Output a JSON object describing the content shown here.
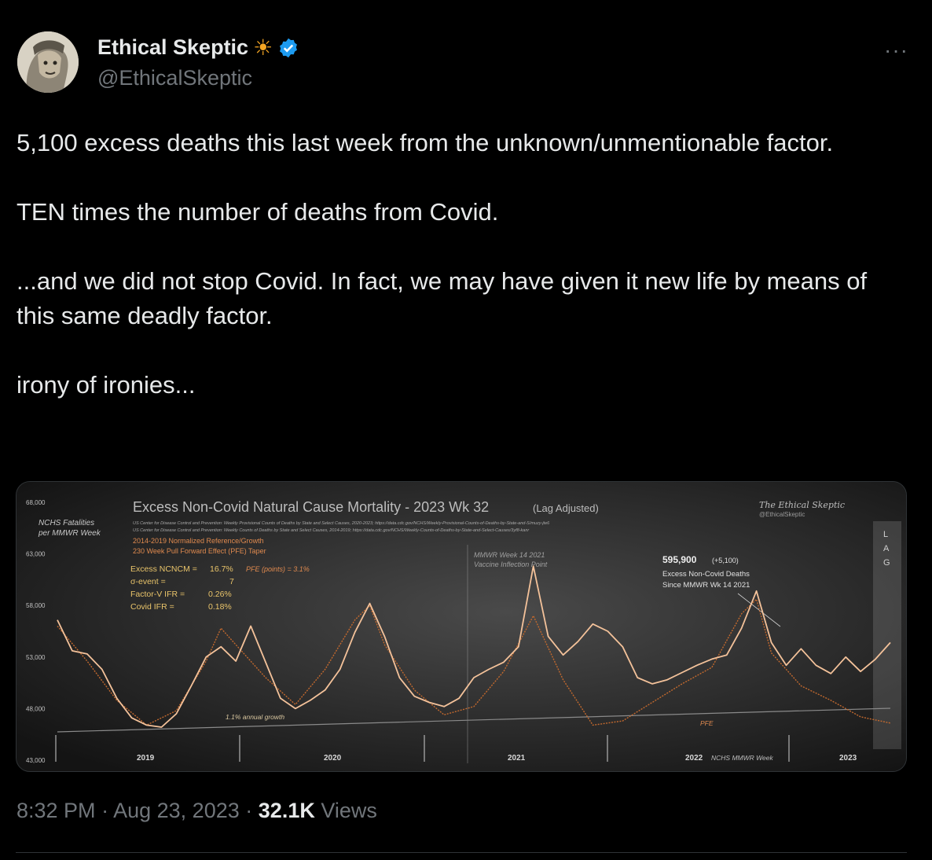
{
  "user": {
    "name": "Ethical Skeptic",
    "handle": "@EthicalSkeptic",
    "sun_emoji": "☀",
    "verified_icon": "verified-badge-icon"
  },
  "menu": {
    "more_label": "···"
  },
  "tweet": {
    "paragraphs": [
      "5,100 excess deaths this last week from the unknown/unmentionable factor.",
      "TEN times the number of deaths from Covid.",
      "...and we did not stop Covid. In fact, we may have given it new life by means of this same deadly factor.",
      "irony of ironies..."
    ]
  },
  "meta": {
    "time": "8:32 PM",
    "date": "Aug 23, 2023",
    "views_count": "32.1K",
    "views_label": "Views",
    "sep": "·"
  },
  "image": {
    "title": "Excess Non-Covid Natural Cause Mortality - 2023 Wk 32",
    "title_suffix": "(Lag Adjusted)",
    "source_line1": "US Center for Disease Control and Prevention: Weekly Provisional Counts of Deaths by State and Select Causes, 2020-2023; https://data.cdc.gov/NCHS/Weekly-Provisional-Counts-of-Deaths-by-State-and-S/muzy-jte6",
    "source_line2": "US Center for Disease Control and Prevention: Weekly Counts of Deaths by State and Select Causes, 2014-2019; https://data.cdc.gov/NCHS/Weekly-Counts-of-Deaths-by-State-and-Select-Causes/3yf8-kanr",
    "ref_line1": "2014-2019 Normalized Reference/Growth",
    "ref_line2": "230 Week Pull Forward Effect (PFE) Taper",
    "ylabel_line1": "NCHS Fatalities",
    "ylabel_line2": "per MMWR Week",
    "brand": "The Ethical Skeptic",
    "brand_handle": "@EthicalSkeptic",
    "stats": [
      {
        "label": "Excess NCNCM =",
        "value": "16.7%"
      },
      {
        "label": "σ-event =",
        "value": "7"
      },
      {
        "label": "Factor-V IFR =",
        "value": "0.26%"
      },
      {
        "label": "Covid IFR =",
        "value": "0.18%"
      }
    ],
    "pfe_points": "PFE (points) = 3.1%",
    "mmwr_note_line1": "MMWR Week 14 2021",
    "mmwr_note_line2": "Vaccine Inflection Point",
    "total": "595,900",
    "total_delta": "(+5,100)",
    "total_line1": "Excess Non-Covid Deaths",
    "total_line2": "Since MMWR Wk 14 2021",
    "growth_label": "1.1% annual growth",
    "pfe_label": "PFE",
    "lag_letters": [
      "L",
      "A",
      "G"
    ],
    "nchs_week_label": "NCHS MMWR Week"
  },
  "chart_data": {
    "type": "line",
    "title": "Excess Non-Covid Natural Cause Mortality - 2023 Wk 32 (Lag Adjusted)",
    "ylabel": "NCHS Fatalities per MMWR Week",
    "xlabel": "NCHS MMWR Week",
    "ylim": [
      43000,
      68000
    ],
    "yticks": [
      "68,000",
      "63,000",
      "58,000",
      "53,000",
      "48,000",
      "43,000"
    ],
    "year_labels": [
      "2019",
      "2020",
      "2021",
      "2022",
      "2023"
    ],
    "grid": false,
    "series": [
      {
        "name": "",
        "color": "#f4c29a",
        "x": [
          0,
          4,
          8,
          12,
          16,
          20,
          24,
          28,
          32,
          36,
          40,
          44,
          48,
          52,
          56,
          60,
          64,
          68,
          72,
          76,
          80,
          84,
          88,
          92,
          96,
          100,
          104,
          108,
          112,
          116,
          120,
          124,
          128,
          132,
          136,
          140,
          144,
          148,
          152,
          156,
          160,
          164,
          168,
          172,
          176,
          180,
          184,
          188,
          192,
          196,
          200,
          204,
          208,
          212,
          216,
          220,
          224
        ],
        "values": [
          56600,
          53600,
          53300,
          51800,
          49000,
          47100,
          46400,
          46200,
          47500,
          50200,
          53000,
          54000,
          52600,
          56000,
          52500,
          49000,
          48000,
          48800,
          49800,
          51800,
          55400,
          58200,
          55000,
          51000,
          49200,
          48600,
          48200,
          49000,
          51000,
          51800,
          52500,
          54000,
          61800,
          55000,
          53200,
          54500,
          56200,
          55500,
          54000,
          51000,
          50400,
          50800,
          51500,
          52200,
          52800,
          53200,
          55800,
          59400,
          54400,
          52200,
          53800,
          52200,
          51400,
          53000,
          51600,
          52800,
          54400
        ]
      },
      {
        "name": "PFE",
        "color": "#c2692e",
        "x": [
          0,
          8,
          16,
          24,
          32,
          40,
          44,
          48,
          56,
          64,
          72,
          80,
          84,
          88,
          96,
          104,
          112,
          120,
          128,
          136,
          144,
          152,
          160,
          168,
          176,
          184,
          188,
          192,
          200,
          208,
          216,
          224
        ],
        "values": [
          56000,
          52600,
          48800,
          46400,
          47800,
          52600,
          55800,
          54200,
          51000,
          48400,
          51800,
          56600,
          58000,
          54200,
          49800,
          47400,
          48200,
          51600,
          57000,
          50800,
          46400,
          46800,
          48600,
          50400,
          52000,
          57200,
          58600,
          53400,
          50200,
          48800,
          47200,
          46600
        ]
      }
    ]
  }
}
